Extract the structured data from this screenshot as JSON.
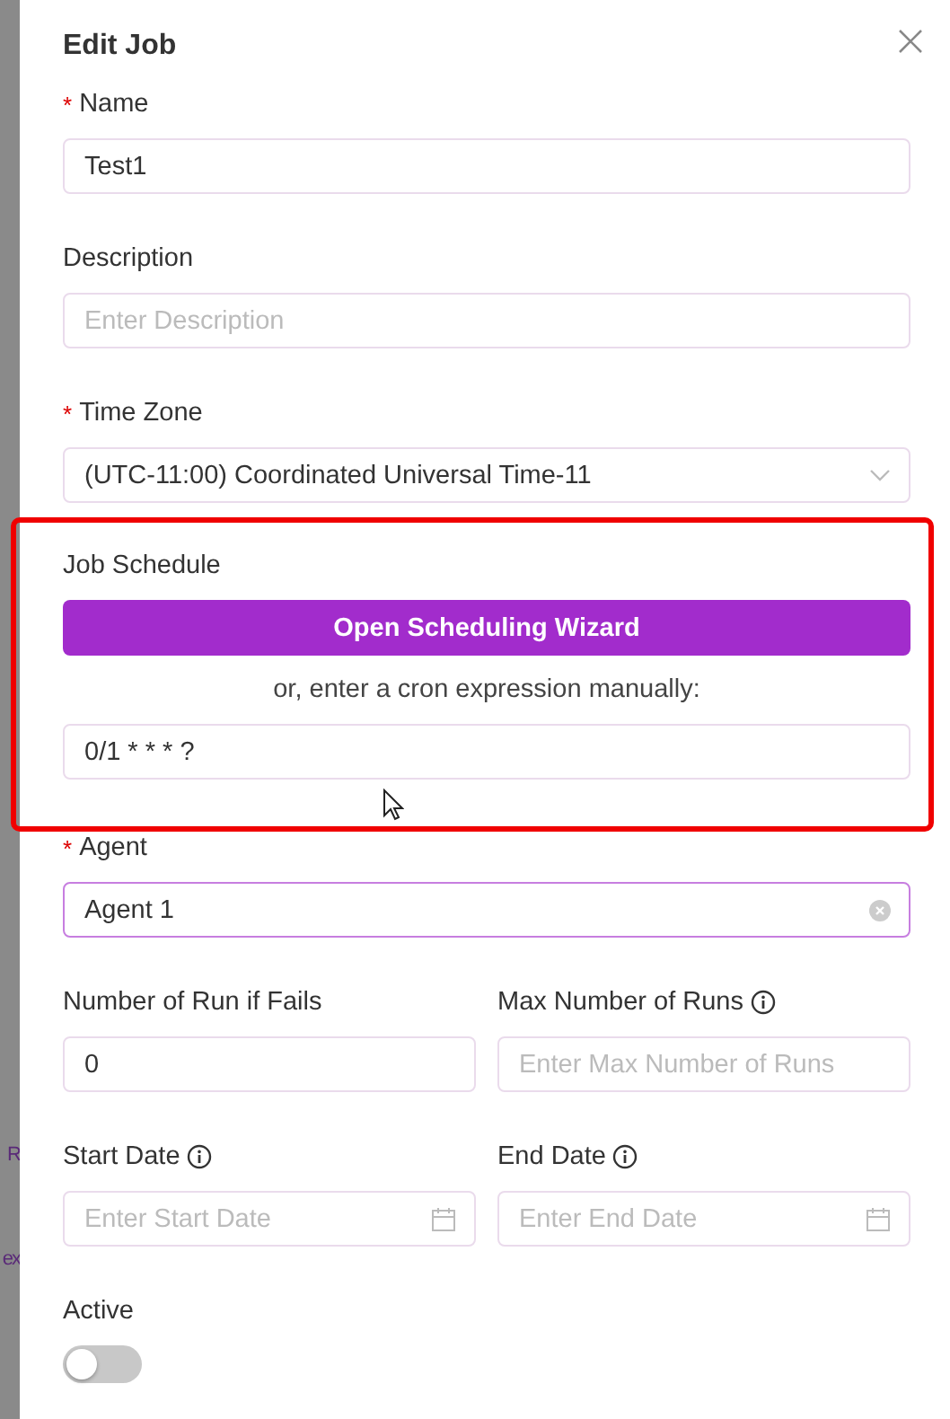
{
  "backdrop": {
    "fragments": [
      "R",
      "ex"
    ]
  },
  "dialog": {
    "title": "Edit Job"
  },
  "sections": [
    {
      "kind": "row",
      "fields": [
        {
          "kind": "text",
          "label": "Name",
          "required_mark": "*",
          "value": "Test1"
        }
      ]
    },
    {
      "kind": "row",
      "fields": [
        {
          "kind": "text",
          "label": "Description",
          "placeholder": "Enter Description"
        }
      ]
    },
    {
      "kind": "row",
      "fields": [
        {
          "kind": "select",
          "label": "Time Zone",
          "required_mark": "*",
          "value": "(UTC-11:00) Coordinated Universal Time-11"
        }
      ]
    },
    {
      "kind": "schedule",
      "label": "Job Schedule",
      "button": "Open Scheduling Wizard",
      "hint": "or, enter a cron expression manually:",
      "value": "0/1 * * * ?",
      "highlighted": true
    },
    {
      "kind": "row",
      "fields": [
        {
          "kind": "clearable",
          "label": "Agent",
          "required_mark": "*",
          "value": "Agent 1",
          "focused": true
        }
      ]
    },
    {
      "kind": "row",
      "fields": [
        {
          "kind": "text",
          "label": "Number of Run if Fails",
          "value": "0"
        },
        {
          "kind": "text",
          "label": "Max Number of Runs",
          "info": true,
          "placeholder": "Enter Max Number of Runs"
        }
      ]
    },
    {
      "kind": "row",
      "fields": [
        {
          "kind": "date",
          "label": "Start Date",
          "info": true,
          "placeholder": "Enter Start Date"
        },
        {
          "kind": "date",
          "label": "End Date",
          "info": true,
          "placeholder": "Enter End Date"
        }
      ]
    },
    {
      "kind": "switch",
      "label": "Active",
      "on": false
    }
  ]
}
